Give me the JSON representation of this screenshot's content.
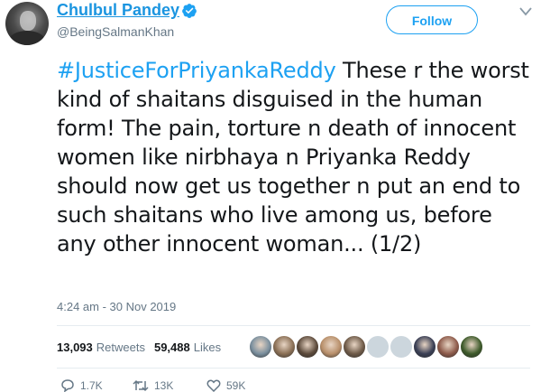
{
  "author": {
    "name": "Chulbul Pandey",
    "handle": "@BeingSalmanKhan",
    "avatar_icon": "profile-photo",
    "verified_icon": "verified-badge-icon"
  },
  "header": {
    "follow_label": "Follow",
    "menu_icon": "chevron-down-icon"
  },
  "tweet": {
    "hashtag": "#JusticeForPriyankaReddy",
    "body": " These r the worst kind of shaitans disguised in the human form! The pain, torture n death of innocent women like nirbhaya n Priyanka Reddy should now get us together n put an end to such shaitans who live among us, before any other innocent woman... (1/2)",
    "timestamp": "4:24 am - 30 Nov 2019"
  },
  "stats": {
    "retweets_count": "13,093",
    "retweets_label": "Retweets",
    "likes_count": "59,488",
    "likes_label": "Likes"
  },
  "likers": [
    {
      "name": "liker-1",
      "color": "#7a8f9e"
    },
    {
      "name": "liker-2",
      "color": "#8a6f55"
    },
    {
      "name": "liker-3",
      "color": "#5c4a3b"
    },
    {
      "name": "liker-4",
      "color": "#b88f6a"
    },
    {
      "name": "liker-5",
      "color": "#6e5a48"
    },
    {
      "name": "liker-6",
      "color": "#ccd6dd"
    },
    {
      "name": "liker-7",
      "color": "#ccd6dd"
    },
    {
      "name": "liker-8",
      "color": "#3a3f55"
    },
    {
      "name": "liker-9",
      "color": "#8d5a4a"
    },
    {
      "name": "liker-10",
      "color": "#3d5a2a"
    }
  ],
  "actions": {
    "reply_count": "1.7K",
    "retweet_count": "13K",
    "like_count": "59K"
  },
  "colors": {
    "accent": "#1da1f2",
    "name_link": "#1b95e0",
    "muted": "#657786"
  }
}
